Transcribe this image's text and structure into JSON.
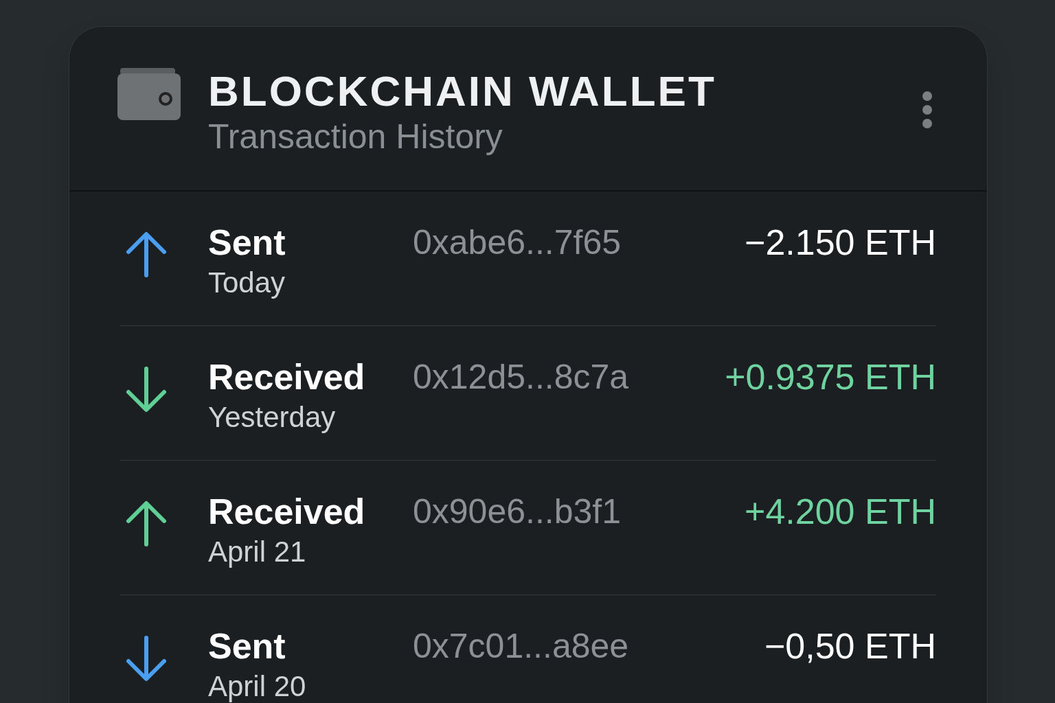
{
  "header": {
    "title": "BLOCKCHAIN WALLET",
    "subtitle": "Transaction History"
  },
  "transactions": [
    {
      "kind": "sent",
      "up": true,
      "type": "Sent",
      "date": "Today",
      "address": "0xabe6...7f65",
      "amount": "−2.150 ETH"
    },
    {
      "kind": "received",
      "up": false,
      "type": "Received",
      "date": "Yesterday",
      "address": "0x12d5...8c7a",
      "amount": "+0.9375 ETH"
    },
    {
      "kind": "received",
      "up": true,
      "type": "Received",
      "date": "April 21",
      "address": "0x90e6...b3f1",
      "amount": "+4.200 ETH"
    },
    {
      "kind": "sent",
      "up": false,
      "type": "Sent",
      "date": "April 20",
      "address": "0x7c01...a8ee",
      "amount": "−0,50 ETH"
    }
  ]
}
